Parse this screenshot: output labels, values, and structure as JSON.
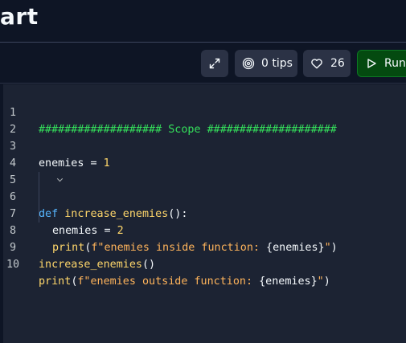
{
  "header": {
    "title": "art"
  },
  "toolbar": {
    "tips_label": "0 tips",
    "likes_label": "26",
    "run_label": "Run"
  },
  "icons": {
    "expand": "expand-arrows-icon",
    "tips": "target-rings-icon",
    "like": "heart-icon",
    "run": "play-triangle-icon"
  },
  "colors": {
    "background": "#0e1525",
    "editor_background": "#1c2333",
    "button": "#2b3245",
    "run_button": "#044a10",
    "comment": "#34e05b",
    "keyword": "#56b6ff",
    "function": "#ffd76b",
    "string": "#ffb45b"
  },
  "editor": {
    "line_numbers": [
      "1",
      "2",
      "3",
      "4",
      "5",
      "6",
      "7",
      "8",
      "9",
      "10"
    ],
    "line1": {
      "comment": "################### Scope ####################"
    },
    "line3": {
      "name": "enemies",
      "op": " = ",
      "value": "1"
    },
    "line5": {
      "kw": "def",
      "name": "increase_enemies",
      "punc": "():"
    },
    "line6": {
      "name": "enemies",
      "op": " = ",
      "value": "2"
    },
    "line7": {
      "fn": "print",
      "open": "(",
      "str": "f\"enemies inside function: ",
      "expr": "{enemies}",
      "close_str": "\"",
      "close": ")"
    },
    "line9": {
      "fn": "increase_enemies",
      "punc": "()"
    },
    "line10": {
      "fn": "print",
      "open": "(",
      "str": "f\"enemies outside function: ",
      "expr": "{enemies}",
      "close_str": "\"",
      "close": ")"
    }
  }
}
